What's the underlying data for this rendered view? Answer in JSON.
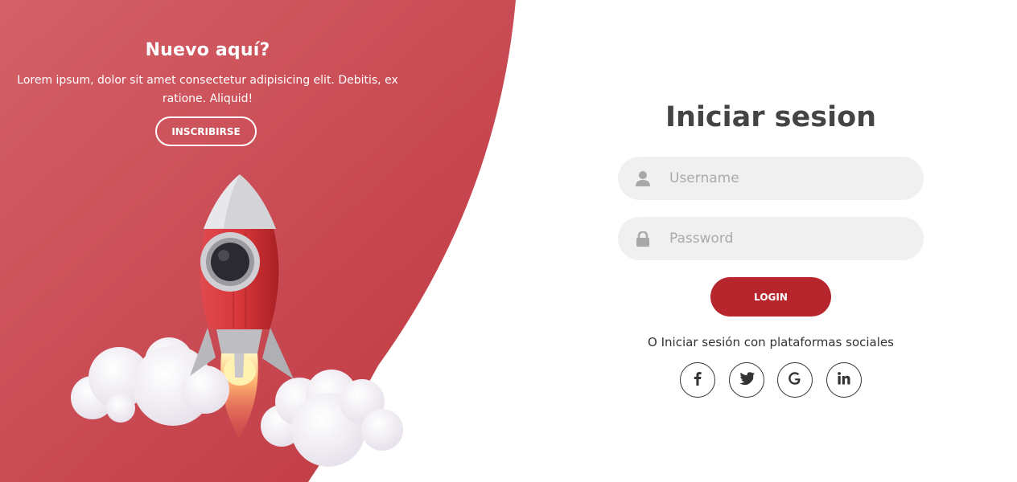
{
  "colors": {
    "accent": "#b8262d",
    "panel_light": "#d05a64",
    "panel_dark": "#c0363f",
    "input_bg": "#f0f0f0",
    "title_text": "#444444"
  },
  "left_panel": {
    "title": "Nuevo aquí?",
    "text": "Lorem ipsum, dolor sit amet consectetur adipisicing elit. Debitis, ex ratione. Aliquid!",
    "signup_label": "INSCRIBIRSE",
    "illustration": "rocket-with-clouds"
  },
  "login_form": {
    "title": "Iniciar sesion",
    "username": {
      "placeholder": "Username",
      "value": "",
      "icon": "user-icon"
    },
    "password": {
      "placeholder": "Password",
      "value": "",
      "icon": "lock-icon"
    },
    "login_label": "LOGIN",
    "social_text": "O Iniciar sesión con plataformas sociales",
    "social": [
      {
        "name": "facebook",
        "icon": "facebook-icon"
      },
      {
        "name": "twitter",
        "icon": "twitter-icon"
      },
      {
        "name": "google",
        "icon": "google-icon"
      },
      {
        "name": "linkedin",
        "icon": "linkedin-icon"
      }
    ]
  }
}
